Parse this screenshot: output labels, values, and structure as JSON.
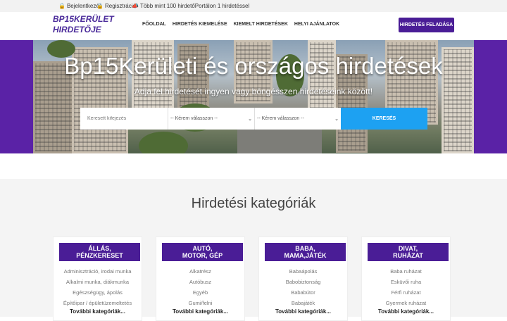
{
  "topbar": {
    "login": "Bejelentkezés",
    "register": "Regisztráció",
    "promo": "Több mint 100 hirdetőPortálon 1 hirdetéssel"
  },
  "header": {
    "logo_line1": "BP15KERÜLET",
    "logo_line2": "HIRDETŐJE",
    "nav": [
      "FŐOLDAL",
      "HIRDETÉS KIEMELÉSE",
      "KIEMELT HIRDETÉSEK",
      "HELYI AJÁNLATOK"
    ],
    "post_button": "HIRDETÉS FELADÁSA"
  },
  "hero": {
    "title": "Bp15Kerületi és országos hirdetések",
    "subtitle": "Adja fel hirdetését ingyen vagy böngésszen hirdetéseink között!",
    "search_placeholder": "Keresett kifejezés",
    "select1": "-- Kérem válasszon --",
    "select2": "-- Kérem válasszon --",
    "search_button": "KERESÉS"
  },
  "categories": {
    "heading": "Hirdetési kategóriák",
    "more_label": "További kategóriák...",
    "cards": [
      {
        "line1": "ÁLLÁS,",
        "line2": "PÉNZKERESET",
        "items": [
          "Adminisztráció, irodai munka",
          "Alkalmi munka, diákmunka",
          "Egészségügy, ápolás",
          "Építőipar / épületüzemeltetés"
        ]
      },
      {
        "line1": "AUTÓ,",
        "line2": "MOTOR, GÉP",
        "items": [
          "Alkatrész",
          "Autóbusz",
          "Egyéb",
          "Gumi/felni"
        ]
      },
      {
        "line1": "BABA,",
        "line2": "MAMA,JÁTÉK",
        "items": [
          "Babaápolás",
          "Babobiztonság",
          "Bababútor",
          "Babajáték"
        ]
      },
      {
        "line1": "DIVAT,",
        "line2": "RUHÁZAT",
        "items": [
          "Baba ruházat",
          "Esküvői ruha",
          "Férfi ruházat",
          "Gyermek ruházat"
        ]
      }
    ]
  },
  "colors": {
    "brand": "#4a1d96",
    "search_button": "#1da1f2"
  }
}
